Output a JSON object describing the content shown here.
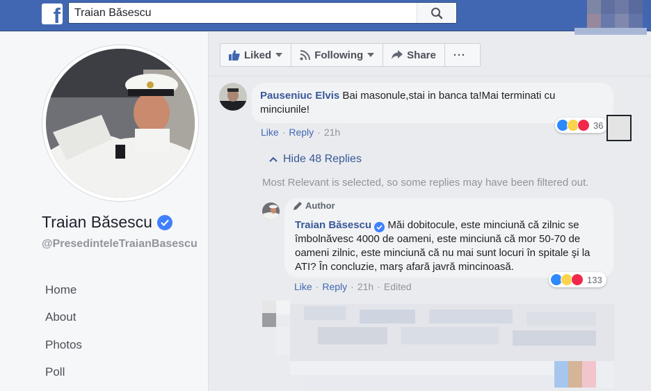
{
  "search": {
    "value": "Traian Băsescu"
  },
  "profile": {
    "name": "Traian Băsescu",
    "handle": "@PresedinteleTraianBasescu"
  },
  "nav": [
    "Home",
    "About",
    "Photos",
    "Poll"
  ],
  "page_buttons": {
    "liked": "Liked",
    "following": "Following",
    "share": "Share",
    "more": "···"
  },
  "comment": {
    "author": "Pauseniuc Elvis",
    "text": "Bai masonule,stai in banca ta!Mai terminati cu minciunile!",
    "like": "Like",
    "reply": "Reply",
    "time": "21h",
    "reaction_count": "36"
  },
  "replies_toggle": "Hide 48 Replies",
  "filtered_note": "Most Relevant is selected, so some replies may have been filtered out.",
  "reply": {
    "badge": "Author",
    "author": "Traian Băsescu",
    "text": "Măi dobitocule, este minciună că zilnic se îmbolnăvesc 4000 de oameni, este minciună că mor 50-70 de oameni zilnic, este minciună că nu mai sunt locuri în spitale şi la ATI? În concluzie, marş afară javră mincinoasă.",
    "like": "Like",
    "reply": "Reply",
    "time": "21h",
    "edited": "Edited",
    "reaction_count": "133"
  },
  "colors": {
    "topbar": "#4267b2",
    "link": "#385898",
    "verified": "#4080ff"
  }
}
